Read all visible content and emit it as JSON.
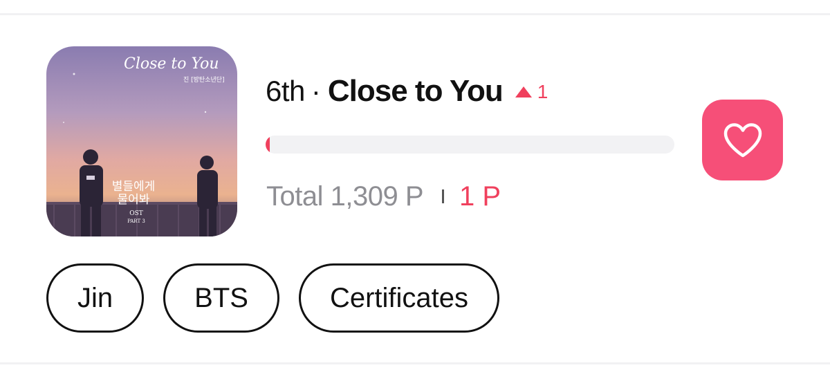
{
  "entry": {
    "rank": "6th",
    "separator": "·",
    "title": "Close to You",
    "trend": {
      "direction": "up",
      "value": "1",
      "icon": "triangle-up-icon"
    },
    "progress": 0.01,
    "total_points": "Total 1,309 P",
    "my_points": "1 P",
    "like_icon": "heart-icon"
  },
  "album_art": {
    "script_title": "Close to You",
    "artist_tag": "진 [방탄소년단]",
    "korean_title_line1": "별들에게",
    "korean_title_line2": "물어봐",
    "ost_line1": "OST",
    "ost_line2": "PART 3"
  },
  "tags": [
    "Jin",
    "BTS",
    "Certificates"
  ],
  "colors": {
    "accent": "#f0405d",
    "like_button": "#f64f78",
    "muted_text": "#8e8e93",
    "track": "#f2f2f4"
  }
}
